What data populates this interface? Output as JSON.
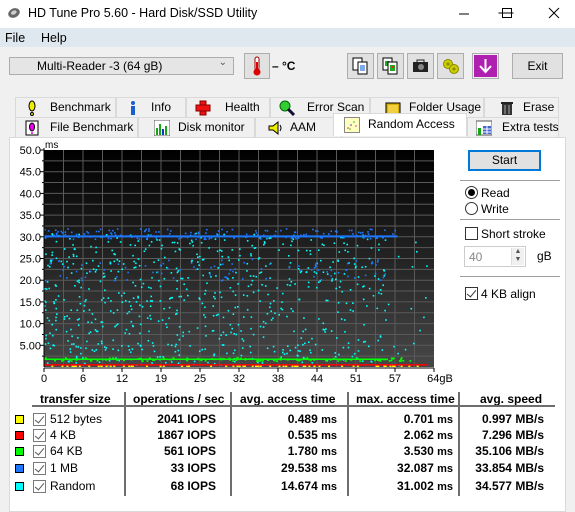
{
  "window": {
    "title": "HD Tune Pro 5.60 - Hard Disk/SSD Utility",
    "minimize_icon": "minimize-icon",
    "maximize_icon": "maximize-icon",
    "close_icon": "close-icon"
  },
  "menu": [
    "File",
    "Help"
  ],
  "toolbar": {
    "drive": "Multi-Reader  -3 (64 gB)",
    "temperature": "– °C",
    "buttons": [
      "copy-text-icon",
      "copy-image-icon",
      "screenshot-camera-icon",
      "options-gears-icon",
      "save-download-icon"
    ],
    "exit_label": "Exit"
  },
  "tabs": {
    "row1": [
      "Benchmark",
      "Info",
      "Health",
      "Error Scan",
      "Folder Usage",
      "Erase"
    ],
    "row2": [
      "File Benchmark",
      "Disk monitor",
      "AAM",
      "Random Access",
      "Extra tests"
    ],
    "active": "Random Access"
  },
  "side": {
    "start_label": "Start",
    "read_label": "Read",
    "write_label": "Write",
    "mode": "Read",
    "short_stroke_label": "Short stroke",
    "short_stroke_checked": false,
    "short_stroke_value": "40",
    "short_stroke_unit": "gB",
    "align_label": "4 KB align",
    "align_checked": true
  },
  "chart_data": {
    "type": "scatter",
    "ylabel": "ms",
    "xlabel": "",
    "ylim": [
      0,
      50
    ],
    "xlim": [
      0,
      64
    ],
    "y_ticks": [
      "50.0",
      "45.0",
      "40.0",
      "35.0",
      "30.0",
      "25.0",
      "20.0",
      "15.0",
      "10.0",
      "5.00"
    ],
    "y_tick_values": [
      50,
      45,
      40,
      35,
      30,
      25,
      20,
      15,
      10,
      5
    ],
    "x_ticks": [
      "0",
      "6",
      "12",
      "19",
      "25",
      "32",
      "38",
      "44",
      "51",
      "57",
      "64gB"
    ],
    "x_tick_values": [
      0,
      6.4,
      12.8,
      19.2,
      25.6,
      32,
      38.4,
      44.8,
      51.2,
      57.6,
      64
    ],
    "grid": true,
    "series": [
      {
        "name": "512 bytes",
        "color": "#ffff00",
        "typical_ms": 0.489,
        "max_ms": 0.701
      },
      {
        "name": "4 KB",
        "color": "#ff0000",
        "typical_ms": 0.535,
        "max_ms": 2.062
      },
      {
        "name": "64 KB",
        "color": "#00ff00",
        "typical_ms": 1.78,
        "max_ms": 3.53
      },
      {
        "name": "1 MB",
        "color": "#1e78ff",
        "typical_ms": 29.538,
        "max_ms": 32.087
      },
      {
        "name": "Random",
        "color": "#00ffff",
        "typical_ms": 14.674,
        "max_ms": 31.002,
        "range_ms": [
          0,
          31
        ]
      }
    ]
  },
  "results": {
    "headers": [
      "transfer size",
      "operations / sec",
      "avg. access time",
      "max. access time",
      "avg. speed"
    ],
    "rows": [
      {
        "color": "#ffff00",
        "checked": true,
        "size": "512 bytes",
        "ops": "2041 IOPS",
        "avg": "0.489",
        "max": "0.701",
        "speed": "0.997 MB/s"
      },
      {
        "color": "#ff0000",
        "checked": true,
        "size": "4 KB",
        "ops": "1867 IOPS",
        "avg": "0.535",
        "max": "2.062",
        "speed": "7.296 MB/s"
      },
      {
        "color": "#00ff00",
        "checked": true,
        "size": "64 KB",
        "ops": "561 IOPS",
        "avg": "1.780",
        "max": "3.530",
        "speed": "35.106 MB/s"
      },
      {
        "color": "#1e78ff",
        "checked": true,
        "size": "1 MB",
        "ops": "33 IOPS",
        "avg": "29.538",
        "max": "32.087",
        "speed": "33.854 MB/s"
      },
      {
        "color": "#00ffff",
        "checked": true,
        "size": "Random",
        "ops": "68 IOPS",
        "avg": "14.674",
        "max": "31.002",
        "speed": "34.577 MB/s"
      }
    ],
    "ms_unit": "ms"
  }
}
